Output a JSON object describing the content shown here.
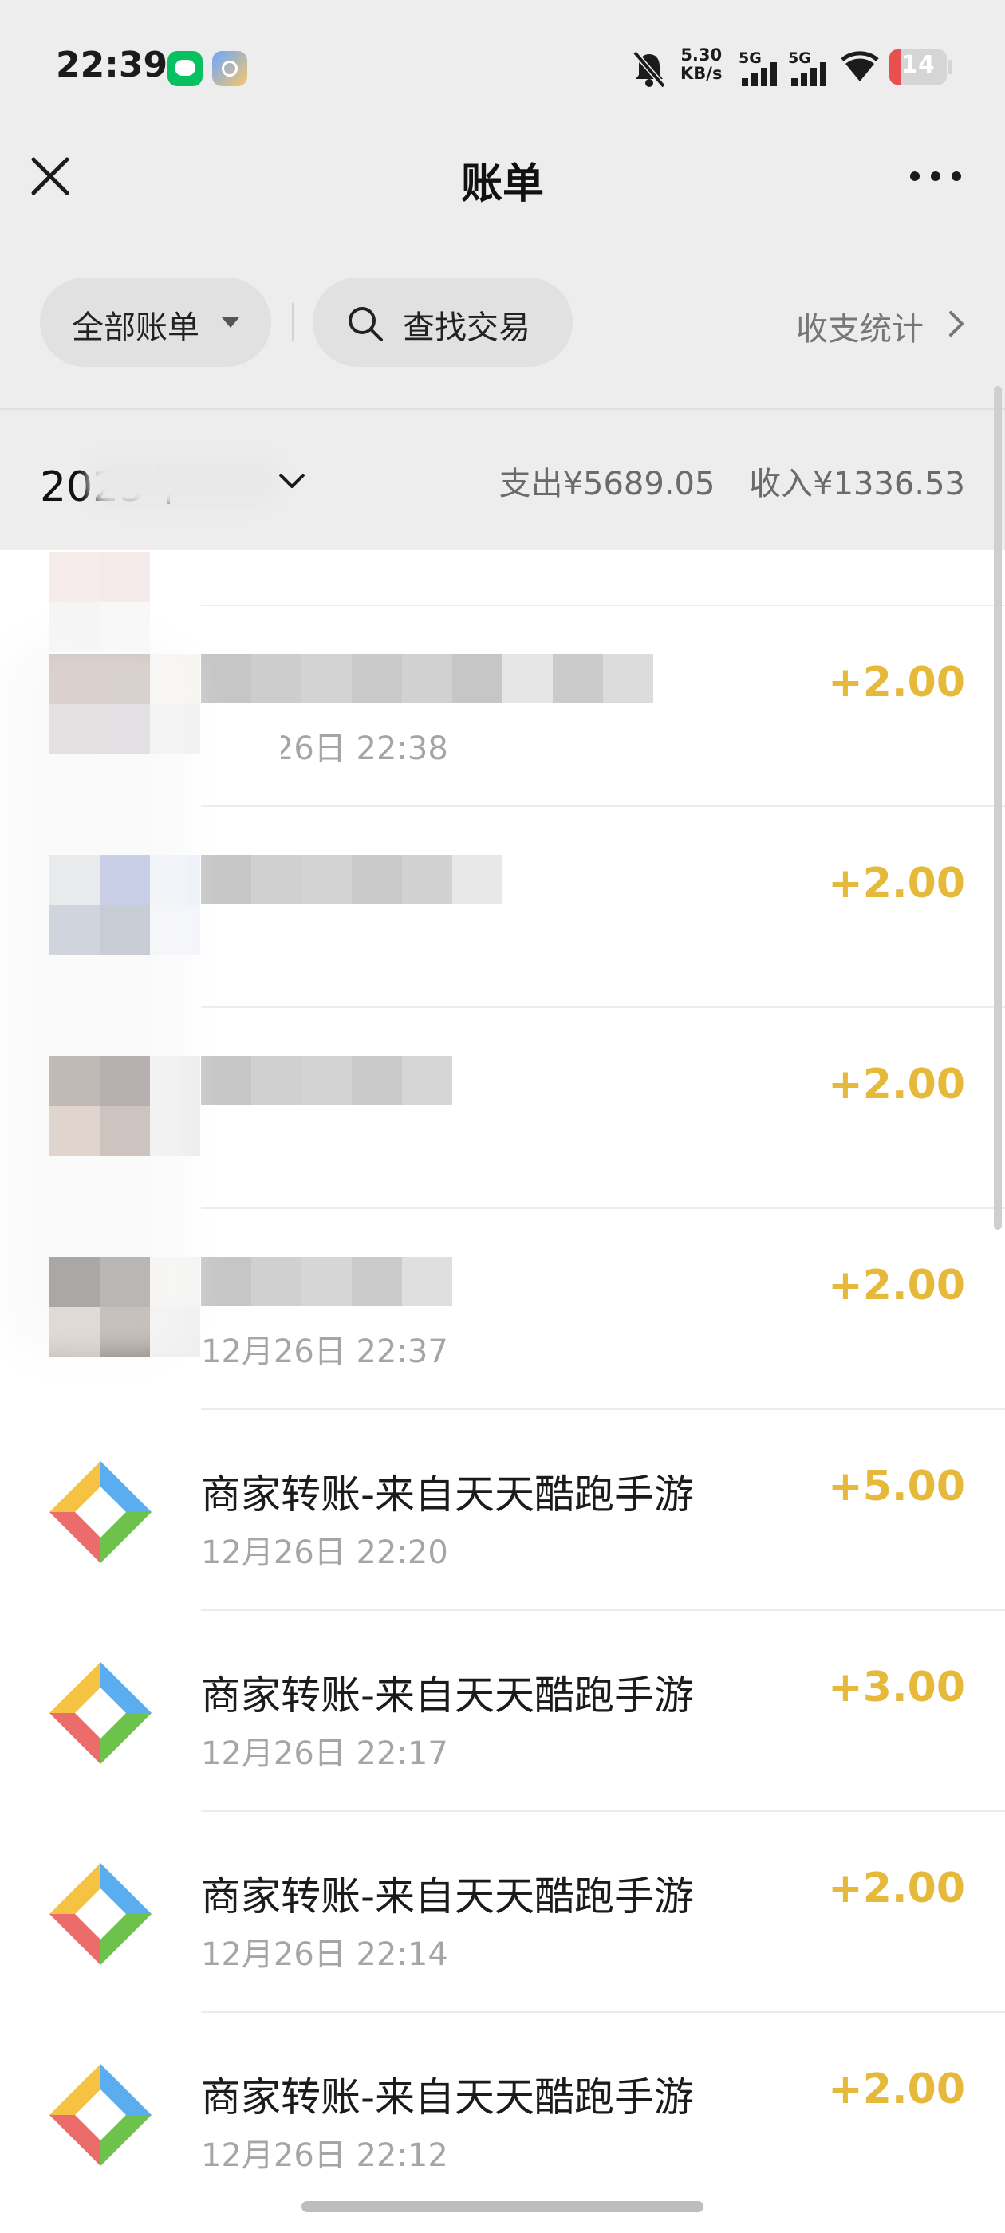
{
  "status_bar": {
    "time": "22:39",
    "net_speed_value": "5.30",
    "net_speed_unit": "KB/s",
    "sim1": "5G",
    "sim2": "5G",
    "battery": "14",
    "icons": [
      "wechat-icon",
      "app-icon",
      "bell-off-icon",
      "signal-icon",
      "wifi-icon",
      "battery-icon"
    ]
  },
  "nav": {
    "title": "账单",
    "close_icon": "close-icon",
    "more_icon": "more-icon"
  },
  "filters": {
    "all_label": "全部账单",
    "search_label": "查找交易",
    "stats_label": "收支统计"
  },
  "month": {
    "label": "2025年",
    "expense": "支出¥5689.05",
    "income": "收入¥1336.53"
  },
  "transactions": [
    {
      "title": "",
      "time": "12月26日 22:38",
      "amount": "+2.00"
    },
    {
      "title": "",
      "time": "",
      "amount": "+2.00"
    },
    {
      "title": "",
      "time": "",
      "amount": "+2.00"
    },
    {
      "title": "",
      "time": "12月26日 22:37",
      "amount": "+2.00"
    },
    {
      "title": "商家转账-来自天天酷跑手游",
      "time": "12月26日 22:20",
      "amount": "+5.00"
    },
    {
      "title": "商家转账-来自天天酷跑手游",
      "time": "12月26日 22:17",
      "amount": "+3.00"
    },
    {
      "title": "商家转账-来自天天酷跑手游",
      "time": "12月26日 22:14",
      "amount": "+2.00"
    },
    {
      "title": "商家转账-来自天天酷跑手游",
      "time": "12月26日 22:12",
      "amount": "+2.00"
    }
  ],
  "colors": {
    "income_amount": "#e6b93b",
    "logo_yellow": "#f5c244",
    "logo_blue": "#5aaef0",
    "logo_green": "#6cc24a",
    "logo_red": "#ec6b6b"
  }
}
